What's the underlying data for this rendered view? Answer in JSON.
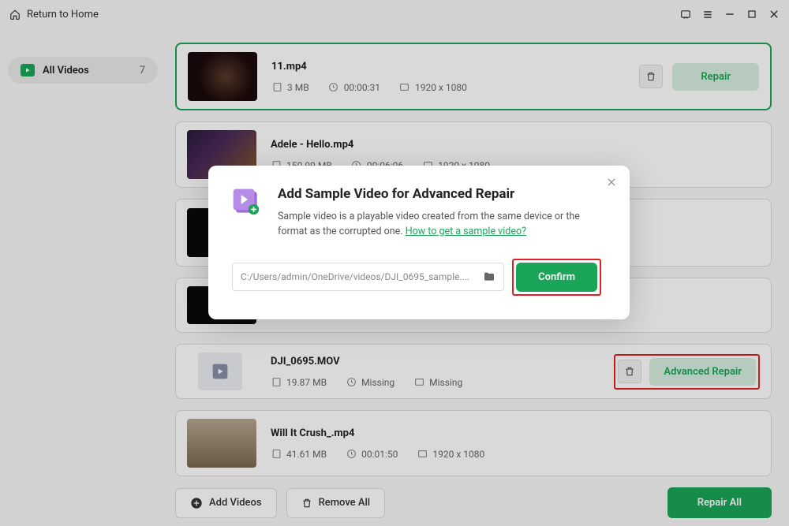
{
  "titlebar": {
    "return_label": "Return to Home"
  },
  "sidebar": {
    "item_label": "All Videos",
    "item_count": "7"
  },
  "videos": [
    {
      "name": "11.mp4",
      "size": "3 MB",
      "duration": "00:00:31",
      "resolution": "1920 x 1080",
      "action": "Repair"
    },
    {
      "name": "Adele - Hello.mp4",
      "size": "150.99 MB",
      "duration": "00:06:06",
      "resolution": "1920 x 1080"
    },
    {
      "name": "DJI_0695.MOV",
      "size": "19.87 MB",
      "duration": "Missing",
      "resolution": "Missing",
      "action": "Advanced Repair"
    },
    {
      "name": "Will It Crush_.mp4",
      "size": "41.61 MB",
      "duration": "00:01:50",
      "resolution": "1920 x 1080"
    }
  ],
  "footer": {
    "add_videos": "Add Videos",
    "remove_all": "Remove All",
    "repair_all": "Repair All"
  },
  "modal": {
    "title": "Add Sample Video for Advanced Repair",
    "desc_prefix": "Sample video is a playable video created from the same device or the format as the corrupted one. ",
    "link_text": "How to get a sample video?",
    "path": "C:/Users/admin/OneDrive/videos/DJI_0695_sample....",
    "confirm": "Confirm"
  }
}
